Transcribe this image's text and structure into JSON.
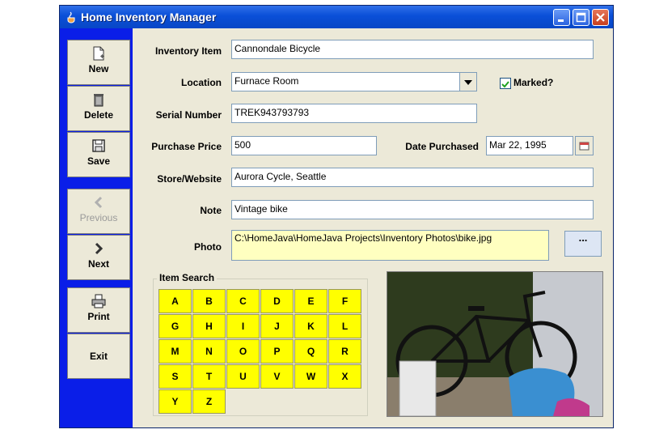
{
  "window": {
    "title": "Home Inventory Manager",
    "accent_color": "#0a1ee8"
  },
  "sidebar": {
    "items": [
      {
        "label": "New",
        "icon": "new-document-icon",
        "enabled": true
      },
      {
        "label": "Delete",
        "icon": "trash-icon",
        "enabled": true
      },
      {
        "label": "Save",
        "icon": "floppy-disk-icon",
        "enabled": true
      },
      {
        "label": "Previous",
        "icon": "left-arrow-icon",
        "enabled": false
      },
      {
        "label": "Next",
        "icon": "right-arrow-icon",
        "enabled": true
      },
      {
        "label": "Print",
        "icon": "printer-icon",
        "enabled": true
      },
      {
        "label": "Exit",
        "icon": "",
        "enabled": true
      }
    ]
  },
  "form": {
    "inventory_item": {
      "label": "Inventory Item",
      "value": "Cannondale Bicycle"
    },
    "location": {
      "label": "Location",
      "value": "Furnace Room"
    },
    "marked": {
      "label": "Marked?",
      "checked": true
    },
    "serial_number": {
      "label": "Serial Number",
      "value": "TREK943793793"
    },
    "purchase_price": {
      "label": "Purchase Price",
      "value": "500"
    },
    "date_purchased": {
      "label": "Date Purchased",
      "value": "Mar 22, 1995"
    },
    "store_website": {
      "label": "Store/Website",
      "value": "Aurora Cycle, Seattle"
    },
    "note": {
      "label": "Note",
      "value": "Vintage bike"
    },
    "photo": {
      "label": "Photo",
      "value": "C:\\HomeJava\\HomeJava Projects\\Inventory Photos\\bike.jpg",
      "browse_label": "..."
    }
  },
  "item_search": {
    "title": "Item Search",
    "letters": [
      "A",
      "B",
      "C",
      "D",
      "E",
      "F",
      "G",
      "H",
      "I",
      "J",
      "K",
      "L",
      "M",
      "N",
      "O",
      "P",
      "Q",
      "R",
      "S",
      "T",
      "U",
      "V",
      "W",
      "X",
      "Y",
      "Z"
    ],
    "button_color": "#ffff00"
  }
}
